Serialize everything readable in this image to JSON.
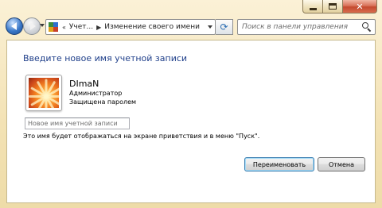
{
  "window": {
    "caption_buttons": {
      "minimize": "minimize",
      "maximize": "maximize",
      "close": "close"
    }
  },
  "navigation": {
    "back_icon": "back-arrow-icon",
    "forward_icon": "forward-arrow-icon"
  },
  "address_bar": {
    "prefix": "«",
    "crumbs": [
      "Учет...",
      "Изменение своего имени"
    ],
    "separator": "▶"
  },
  "search": {
    "placeholder": "Поиск в панели управления"
  },
  "main": {
    "heading": "Введите новое имя учетной записи",
    "user": {
      "name": "DImaN",
      "role": "Администратор",
      "password_status": "Защищена паролем"
    },
    "new_name_field": {
      "value": "",
      "placeholder": "Новое имя учетной записи"
    },
    "hint": "Это имя будет отображаться на экране приветствия и в меню \"Пуск\".",
    "buttons": {
      "rename": "Переименовать",
      "cancel": "Отмена"
    }
  },
  "colors": {
    "heading": "#1f3f8a",
    "frame": "#f3e2b4",
    "accent": "#3a78c9"
  }
}
